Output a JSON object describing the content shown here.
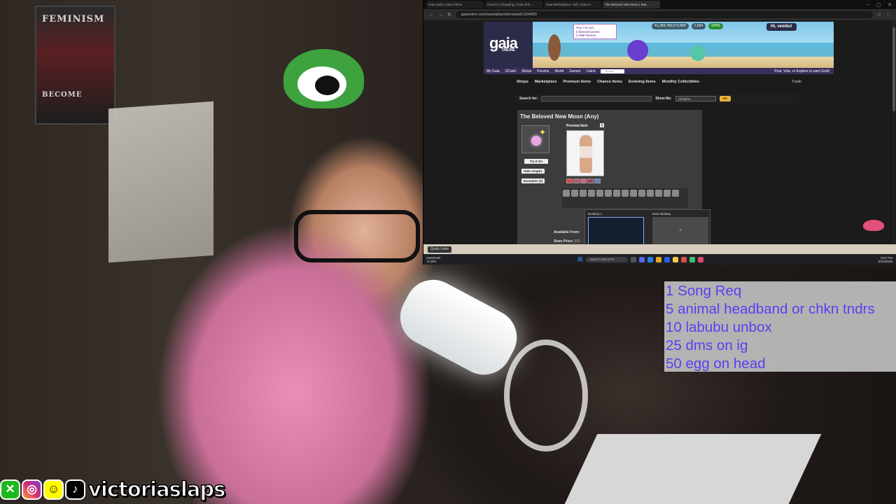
{
  "browser": {
    "tabs": [
      "Gaia Daily | Gaia Online",
      "Cloud 9 | Shopping | Gaia Onli…",
      "Gaia Marketplace: Sell | Gaia O…",
      "The Beloved New Moon | Mar…"
    ],
    "url": "gaiaonline.com/marketplace/itemdetail/11194059"
  },
  "gaia": {
    "logo": "gaia",
    "logo_sub": "ONLINE",
    "notice_lines": [
      "Hey, I've got...",
      "5 flamanimanials",
      "2 Wall Notices"
    ],
    "gold": "41,369,769,572,899",
    "cash": "1,594",
    "percent": "100%",
    "greeting": "Hi, vembu!",
    "nav": [
      "My Gaia",
      "GCash",
      "Shops",
      "Forums",
      "World",
      "Games",
      "Catch"
    ],
    "nav_search": "Search",
    "nav_earn": "Post, Vote, or Explore to earn Gold!",
    "subnav": [
      "Shops",
      "Marketplace",
      "Premium Items",
      "Chance Items",
      "Evolving Items",
      "Monthly Collectibles"
    ],
    "trade": "Trade",
    "search_label": "Search for:",
    "show_me_label": "Show Me:",
    "show_me_value": "All Items",
    "go_label": "Go",
    "item_title": "The Beloved New Moon (Any)",
    "try_on": "Try It On",
    "hide_graphs": "Hide Graphs",
    "examples": "Examples (2)",
    "preview_label": "Preview Item",
    "close_label": "x",
    "available_from": "Available From:",
    "store_price_label": "Store Price:",
    "store_price_value": "550"
  },
  "taskview": {
    "desktop1": "Desktop 1",
    "new_desktop": "New desktop",
    "new_symbol": "+"
  },
  "bookmarks": {
    "chip": "Quick Links"
  },
  "taskbar": {
    "weather": [
      "USD/EUR",
      "-0.34%"
    ],
    "search": "Search web & PC",
    "time": "8:57 PM",
    "date": "8/22/2025"
  },
  "commands": [
    "1 Song Req",
    "5 animal headband or chkn tndrs",
    "10 labubu unbox",
    "25 dms on ig",
    "50 egg on head"
  ],
  "social": {
    "handle": "victoriaslaps",
    "icons": [
      "xbox-icon",
      "instagram-icon",
      "snapchat-icon",
      "tiktok-icon"
    ]
  },
  "colors": {
    "command_text": "#5a3ff0",
    "command_bg": "#bebebe",
    "gaia_nav": "#3a2f5e",
    "go_button": "#e8b33a"
  },
  "poster_text": [
    "FEMINISM",
    "BECOME"
  ]
}
